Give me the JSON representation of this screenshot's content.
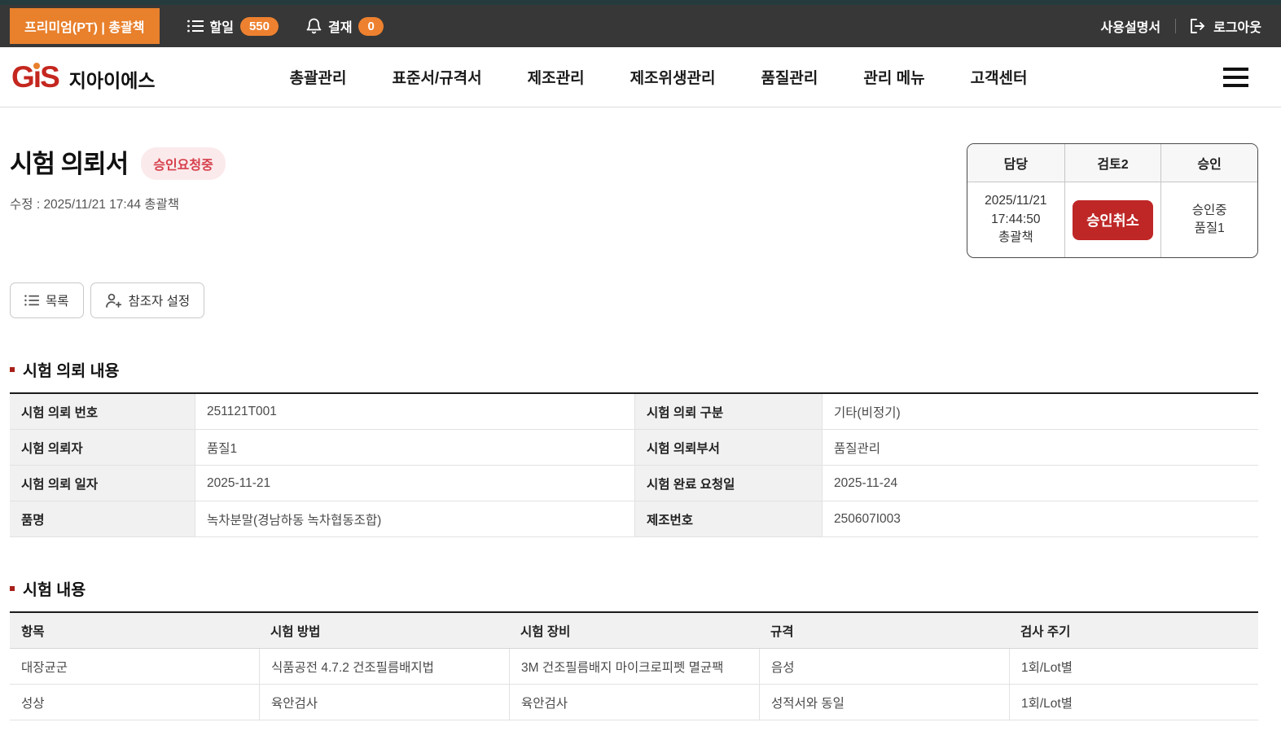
{
  "colors": {
    "accent_orange": "#E8802C",
    "danger_red": "#BF2727",
    "status_badge_bg": "#FBEAEC",
    "status_badge_text": "#D6404B",
    "topbar_bg": "#373737",
    "top_strip": "#263B3E",
    "logo_red": "#C4271F"
  },
  "icons": {
    "todo": "list-icon",
    "approval": "bell-icon",
    "logout": "logout-icon",
    "menu": "hamburger-icon",
    "list_button": "list-icon",
    "referrer_button": "person-plus-icon",
    "section_bullet": "red-square-bullet"
  },
  "topbar": {
    "premium_badge": "프리미엄(PT) | 총괄책",
    "todo": {
      "label": "할일",
      "count": "550"
    },
    "approval": {
      "label": "결재",
      "count": "0"
    },
    "manual": "사용설명서",
    "logout": "로그아웃"
  },
  "navbar": {
    "logo": {
      "g": "G",
      "i": "ı",
      "s": "S",
      "company": "지아이에스"
    },
    "items": [
      "총괄관리",
      "표준서/규격서",
      "제조관리",
      "제조위생관리",
      "품질관리",
      "관리 메뉴",
      "고객센터"
    ]
  },
  "page": {
    "title": "시험 의뢰서",
    "status_badge": "승인요청중",
    "modified": "수정 : 2025/11/21 17:44  총괄책"
  },
  "approval_box": {
    "headers": [
      "담당",
      "검토2",
      "승인"
    ],
    "manager_cell": "2025/11/21\n17:44:50\n총괄책",
    "cancel_button": "승인취소",
    "approver_cell": "승인중\n품질1"
  },
  "toolbar": {
    "list_button": "목록",
    "referrer_button": "참조자 설정"
  },
  "request_section": {
    "title": "시험 의뢰 내용",
    "rows": [
      {
        "l1": "시험 의뢰 번호",
        "v1": "251121T001",
        "l2": "시험 의뢰 구분",
        "v2": "기타(비정기)"
      },
      {
        "l1": "시험 의뢰자",
        "v1": "품질1",
        "l2": "시험 의뢰부서",
        "v2": "품질관리"
      },
      {
        "l1": "시험 의뢰 일자",
        "v1": "2025-11-21",
        "l2": "시험 완료 요청일",
        "v2": "2025-11-24"
      },
      {
        "l1": "품명",
        "v1": "녹차분말(경남하동 녹차협동조합)",
        "l2": "제조번호",
        "v2": "250607I003"
      }
    ]
  },
  "test_section": {
    "title": "시험 내용",
    "headers": [
      "항목",
      "시험 방법",
      "시험 장비",
      "규격",
      "검사 주기"
    ],
    "rows": [
      [
        "대장균군",
        "식품공전 4.7.2 건조필름배지법",
        "3M 건조필름배지 마이크로피펫 멸균팩",
        "음성",
        "1회/Lot별"
      ],
      [
        "성상",
        "육안검사",
        "육안검사",
        "성적서와 동일",
        "1회/Lot별"
      ]
    ]
  }
}
